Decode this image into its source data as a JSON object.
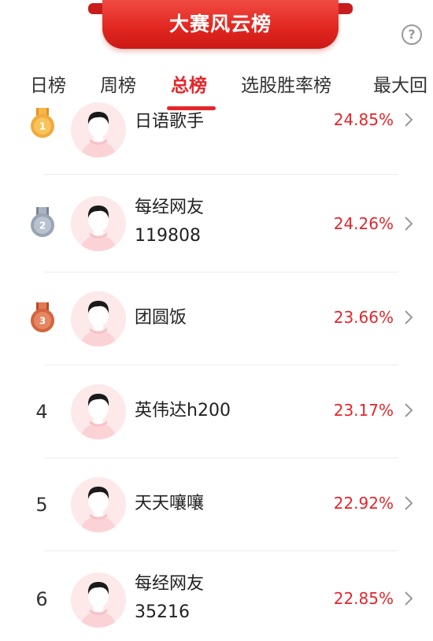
{
  "header": {
    "title": "大赛风云榜",
    "help_icon": "?"
  },
  "tabs": [
    {
      "label": "日榜",
      "active": false
    },
    {
      "label": "周榜",
      "active": false
    },
    {
      "label": "总榜",
      "active": true
    },
    {
      "label": "选股胜率榜",
      "active": false
    },
    {
      "label": "最大回",
      "active": false
    }
  ],
  "colors": {
    "accent": "#e4262b",
    "banner": "#e0251f",
    "gold": "#f2a93b",
    "silver": "#9aa4b3",
    "bronze": "#d2643e"
  },
  "rows": [
    {
      "rank": "1",
      "medal": "gold-medal-icon",
      "medal_text": "1",
      "name": "日语歌手",
      "name2": "",
      "rate": "24.85%"
    },
    {
      "rank": "2",
      "medal": "silver-medal-icon",
      "medal_text": "2",
      "name": "每经网友",
      "name2": "119808",
      "rate": "24.26%"
    },
    {
      "rank": "3",
      "medal": "bronze-medal-icon",
      "medal_text": "3",
      "name": "团圆饭",
      "name2": "",
      "rate": "23.66%"
    },
    {
      "rank": "4",
      "medal": "",
      "medal_text": "",
      "name": "英伟达h200",
      "name2": "",
      "rate": "23.17%"
    },
    {
      "rank": "5",
      "medal": "",
      "medal_text": "",
      "name": "天天嚷嚷",
      "name2": "",
      "rate": "22.92%"
    },
    {
      "rank": "6",
      "medal": "",
      "medal_text": "",
      "name": "每经网友",
      "name2": "35216",
      "rate": "22.85%"
    }
  ]
}
